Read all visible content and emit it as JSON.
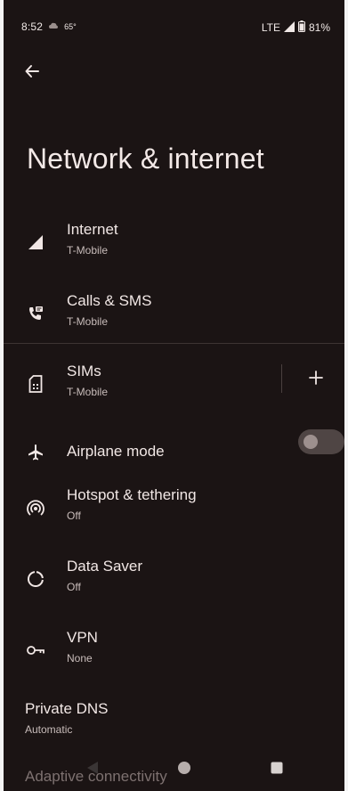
{
  "status_bar": {
    "time": "8:52",
    "temperature": "65°",
    "network": "LTE",
    "battery": "81%"
  },
  "header": {
    "back_icon": "arrow-back-icon",
    "title": "Network & internet"
  },
  "items": [
    {
      "title": "Internet",
      "subtitle": "T-Mobile",
      "icon": "signal-icon"
    },
    {
      "title": "Calls & SMS",
      "subtitle": "T-Mobile",
      "icon": "calls-sms-icon"
    },
    {
      "title": "SIMs",
      "subtitle": "T-Mobile",
      "icon": "sim-card-icon"
    },
    {
      "title": "Airplane mode",
      "subtitle": "",
      "icon": "airplane-icon"
    },
    {
      "title": "Hotspot & tethering",
      "subtitle": "Off",
      "icon": "hotspot-icon"
    },
    {
      "title": "Data Saver",
      "subtitle": "Off",
      "icon": "data-saver-icon"
    },
    {
      "title": "VPN",
      "subtitle": "None",
      "icon": "vpn-key-icon"
    },
    {
      "title": "Private DNS",
      "subtitle": "Automatic",
      "icon": ""
    }
  ],
  "airplane_toggle": {
    "on": false
  },
  "sims_add_icon": "plus-icon",
  "cutoff_item": "Adaptive connectivity",
  "nav_bar": {
    "back_icon": "nav-back-icon",
    "home_icon": "nav-home-icon",
    "recents_icon": "nav-recents-icon"
  },
  "colors": {
    "background": "#1b1414",
    "text_primary": "#f1e7e5",
    "text_secondary": "#c8bcba"
  }
}
